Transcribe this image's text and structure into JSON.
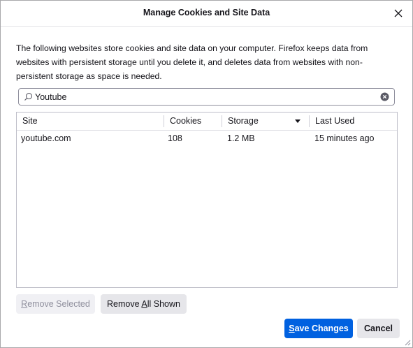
{
  "window": {
    "title": "Manage Cookies and Site Data"
  },
  "description": "The following websites store cookies and site data on your computer. Firefox keeps data from websites with persistent storage until you delete it, and deletes data from websites with non-persistent storage as space is needed.",
  "search": {
    "value": "Youtube",
    "icon": "search-icon"
  },
  "table": {
    "columns": [
      "Site",
      "Cookies",
      "Storage",
      "Last Used"
    ],
    "sorted_column": "Storage",
    "rows": [
      {
        "site": "youtube.com",
        "cookies": "108",
        "storage": "1.2 MB",
        "last_used": "15 minutes ago"
      }
    ]
  },
  "buttons": {
    "remove_selected": {
      "label_pre": "",
      "label_ul": "R",
      "label_post": "emove Selected",
      "enabled": false
    },
    "remove_all_shown": {
      "label_pre": "Remove ",
      "label_ul": "A",
      "label_post": "ll Shown"
    },
    "save_changes": {
      "label_pre": "",
      "label_ul": "S",
      "label_post": "ave Changes"
    },
    "cancel": {
      "label": "Cancel"
    }
  },
  "colors": {
    "primary": "#0061e0",
    "border": "#8f8f9d"
  }
}
